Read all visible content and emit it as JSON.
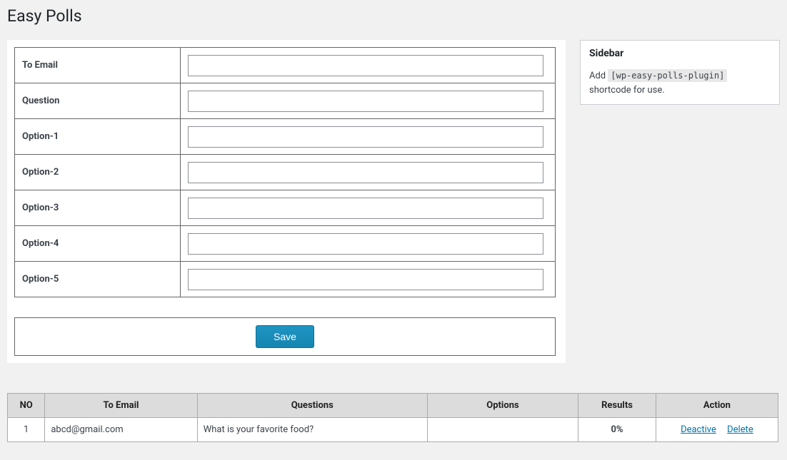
{
  "page": {
    "title": "Easy Polls"
  },
  "form": {
    "fields": [
      {
        "label": "To Email",
        "value": ""
      },
      {
        "label": "Question",
        "value": ""
      },
      {
        "label": "Option-1",
        "value": ""
      },
      {
        "label": "Option-2",
        "value": ""
      },
      {
        "label": "Option-3",
        "value": ""
      },
      {
        "label": "Option-4",
        "value": ""
      },
      {
        "label": "Option-5",
        "value": ""
      }
    ],
    "save_label": "Save"
  },
  "sidebar": {
    "heading": "Sidebar",
    "text_before": "Add ",
    "shortcode": "[wp-easy-polls-plugin]",
    "text_after": " shortcode for use."
  },
  "list": {
    "headers": {
      "no": "NO",
      "email": "To Email",
      "questions": "Questions",
      "options": "Options",
      "results": "Results",
      "action": "Action"
    },
    "rows": [
      {
        "no": "1",
        "email": "abcd@gmail.com",
        "question": "What is your favorite food?",
        "options": "",
        "results": "0%",
        "deactive_label": "Deactive",
        "delete_label": "Delete"
      }
    ]
  }
}
